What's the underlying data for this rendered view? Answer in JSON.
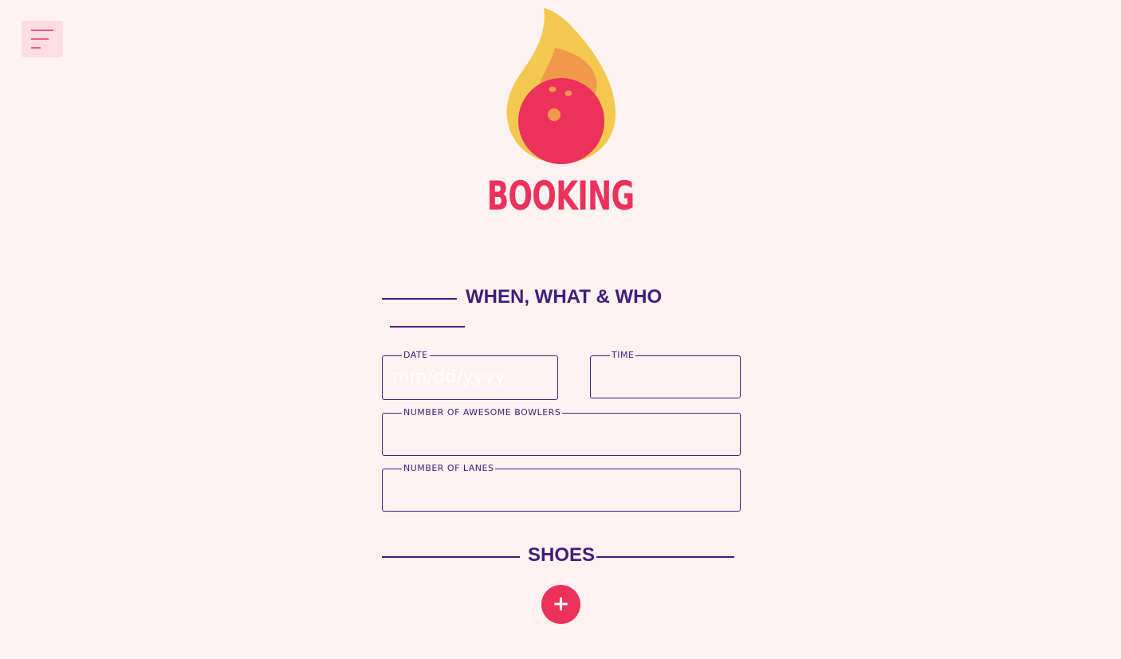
{
  "header": {
    "menu_icon": "hamburger-menu-icon",
    "logo_icon": "flaming-bowling-ball-logo",
    "title": "BOOKING"
  },
  "sections": {
    "when_what_who": {
      "heading": "WHEN, WHAT & WHO",
      "fields": {
        "date": {
          "label": "DATE",
          "placeholder": "mm/dd/yyyy",
          "value": ""
        },
        "time": {
          "label": "TIME",
          "value": ""
        },
        "bowlers": {
          "label": "NUMBER OF AWESOME BOWLERS",
          "value": ""
        },
        "lanes": {
          "label": "NUMBER OF LANES",
          "value": ""
        }
      }
    },
    "shoes": {
      "heading": "SHOES",
      "add_button_label": "+",
      "add_icon": "plus-icon"
    }
  },
  "colors": {
    "background": "#fff2f2",
    "accent": "#ec315a",
    "primary": "#3f1d7a",
    "menu_bg": "#ffdce6",
    "flame_outer": "#f2c84e",
    "flame_inner": "#f0994a"
  }
}
